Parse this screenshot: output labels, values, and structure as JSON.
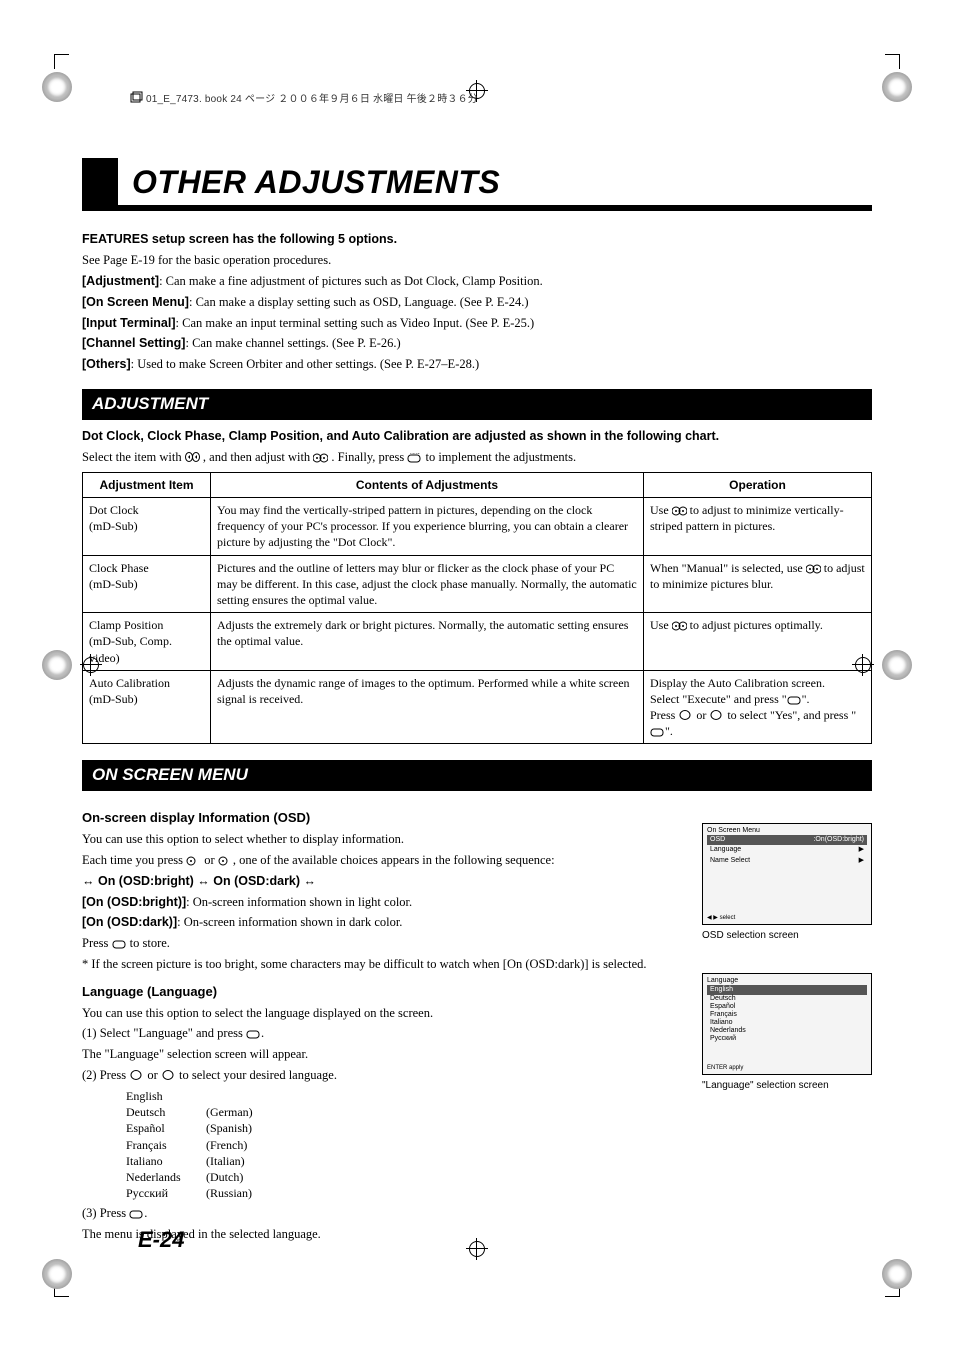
{
  "meta_header": "01_E_7473. book  24 ページ  ２００６年９月６日  水曜日  午後２時３６分",
  "title": "OTHER ADJUSTMENTS",
  "features_heading": "FEATURES setup screen has the following 5 options.",
  "features_sub": "See Page E-19 for the basic operation procedures.",
  "feat": {
    "adj_l": "[Adjustment]",
    "adj_t": ": Can make a fine adjustment of pictures such as Dot Clock, Clamp Position.",
    "osm_l": "[On Screen Menu]",
    "osm_t": ": Can make a display setting such as OSD, Language. (See P. E-24.)",
    "inp_l": "[Input Terminal]",
    "inp_t": ": Can make an input terminal setting such as Video Input. (See P. E-25.)",
    "chn_l": "[Channel Setting]",
    "chn_t": ": Can make channel settings. (See P. E-26.)",
    "oth_l": "[Others]",
    "oth_t": ": Used to make Screen Orbiter and other settings. (See P. E-27–E-28.)"
  },
  "sect_adjustment": "ADJUSTMENT",
  "adj_intro_bold": "Dot Clock, Clock Phase, Clamp Position, and Auto Calibration are adjusted as shown in the following chart.",
  "adj_intro_a": "Select the item with ",
  "adj_intro_b": " , and then adjust with ",
  "adj_intro_c": ". Finally, press ",
  "adj_intro_d": " to implement the adjustments.",
  "tbl": {
    "h1": "Adjustment Item",
    "h2": "Contents of Adjustments",
    "h3": "Operation",
    "r1n": "Dot Clock\n(mD-Sub)",
    "r1c": "You may find the vertically-striped pattern in pictures, depending on the clock frequency of your PC's processor. If you experience blurring, you can obtain a clearer picture by adjusting the \"Dot Clock\".",
    "r1o_a": "Use ",
    "r1o_b": " to adjust to minimize vertically-striped pattern in pictures.",
    "r2n": "Clock Phase\n(mD-Sub)",
    "r2c": "Pictures and the outline of letters may blur or flicker as the clock phase of your PC may be different. In this case, adjust the clock phase manually. Normally, the automatic setting ensures the optimal value.",
    "r2o_a": "When \"Manual\" is selected, use ",
    "r2o_b": " to adjust to minimize pictures blur.",
    "r3n": "Clamp Position\n(mD-Sub, Comp. video)",
    "r3c": "Adjusts the extremely dark or bright pictures. Normally, the automatic setting ensures the optimal value.",
    "r3o_a": "Use ",
    "r3o_b": " to adjust pictures optimally.",
    "r4n": "Auto Calibration\n(mD-Sub)",
    "r4c": "Adjusts the dynamic range of images to the optimum. Performed while a white screen signal is received.",
    "r4o_a": "Display the Auto Calibration screen.\nSelect \"Execute\" and press \"",
    "r4o_b": "\".\nPress ",
    "r4o_c": " or ",
    "r4o_d": " to select \"Yes\", and press \"",
    "r4o_e": "\"."
  },
  "sect_osm": "ON SCREEN MENU",
  "osd_h": "On-screen display Information (OSD)",
  "osd_p1": "You can use this option to select whether to display information.",
  "osd_p2a": "Each time you press ",
  "osd_p2b": " or ",
  "osd_p2c": ", one of the available choices appears in the following sequence:",
  "osd_seq": " On (OSD:bright) ↔ On (OSD:dark) ↔",
  "osd_l1a": "[On (OSD:bright)]",
  "osd_l1b": ":  On-screen information shown in light color.",
  "osd_l2a": "[On (OSD:dark)]",
  "osd_l2b": ":    On-screen information shown in dark color.",
  "osd_store_a": "Press ",
  "osd_store_b": " to store.",
  "osd_note": "* If the screen picture is too bright, some characters may be difficult to watch when [On (OSD:dark)] is selected.",
  "lang_h": "Language (Language)",
  "lang_p1": "You can use this option to select the language displayed on the screen.",
  "lang_s1a": "(1) Select \"Language\" and press ",
  "lang_s1b": ".",
  "lang_s1c": "The \"Language\" selection screen will appear.",
  "lang_s2a": "(2) Press ",
  "lang_s2b": " or ",
  "lang_s2c": " to select your desired language.",
  "langs": {
    "en": "English",
    "en2": "",
    "de": "Deutsch",
    "de2": "(German)",
    "es": "Español",
    "es2": "(Spanish)",
    "fr": "Français",
    "fr2": "(French)",
    "it": "Italiano",
    "it2": "(Italian)",
    "nl": "Nederlands",
    "nl2": "(Dutch)",
    "ru": "Русский",
    "ru2": "(Russian)"
  },
  "lang_s3a": "(3) Press ",
  "lang_s3b": ".",
  "lang_s3c": "The menu is displayed in the selected language.",
  "osdbox1": {
    "title": "On Screen Menu",
    "r1l": "OSD",
    "r1v": ":On(OSD:bright)",
    "r2l": "Language",
    "r2v": "▶",
    "r3l": "Name Select",
    "r3v": "▶",
    "foot": "◀ ▶  select"
  },
  "osdbox1_cap": "OSD selection screen",
  "osdbox2": {
    "title": "Language",
    "items": [
      "English",
      "Deutsch",
      "Español",
      "Français",
      "Italiano",
      "Nederlands",
      "Русский"
    ],
    "foot": "ENTER  apply"
  },
  "osdbox2_cap": "\"Language\" selection screen",
  "pagenum": "E-24"
}
